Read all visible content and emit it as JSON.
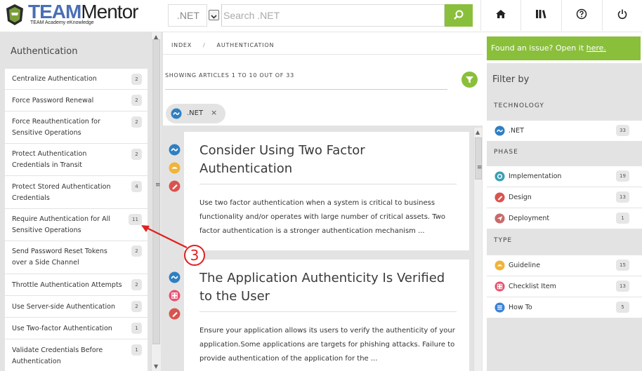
{
  "header": {
    "logo_brand": "TEAM",
    "logo_suffix": "Mentor",
    "logo_subtitle": "TEAM Academy eKnowledge",
    "technology_select": ".NET",
    "search_placeholder": "Search .NET",
    "icons": [
      "home-icon",
      "library-icon",
      "help-icon",
      "power-icon"
    ]
  },
  "left_sidebar": {
    "title": "Authentication",
    "items": [
      {
        "label": "Centralize Authentication",
        "count": "2"
      },
      {
        "label": "Force Password Renewal",
        "count": "2"
      },
      {
        "label": "Force Reauthentication for Sensitive Operations",
        "count": "2"
      },
      {
        "label": "Protect Authentication Credentials in Transit",
        "count": "2"
      },
      {
        "label": "Protect Stored Authentication Credentials",
        "count": "4"
      },
      {
        "label": "Require Authentication for All Sensitive Operations",
        "count": "11"
      },
      {
        "label": "Send Password Reset Tokens over a Side Channel",
        "count": "2"
      },
      {
        "label": "Throttle Authentication Attempts",
        "count": "2"
      },
      {
        "label": "Use Server-side Authentication",
        "count": "2"
      },
      {
        "label": "Use Two-factor Authentication",
        "count": "1"
      },
      {
        "label": "Validate Credentials Before Authentication",
        "count": "1"
      }
    ]
  },
  "breadcrumb": {
    "index": "INDEX",
    "separator": "/",
    "current": "AUTHENTICATION"
  },
  "results": {
    "showing_text": "SHOWING ARTICLES 1 TO 10 OUT OF 33",
    "active_filter": ".NET",
    "remove_symbol": "×"
  },
  "articles": [
    {
      "title": "Consider Using Two Factor Authentication",
      "body": "Use two factor authentication when a system is critical to business functionality and/or operates with large number of critical assets. Two factor authentication is a stronger authentication mechanism ...",
      "icons": [
        "dotnet-icon",
        "guideline-icon",
        "design-icon"
      ]
    },
    {
      "title": "The Application Authenticity Is Verified to the User",
      "body": "Ensure your application allows its users to verify the authenticity of your application.Some applications are targets for phishing attacks. Failure to provide authentication of the application for the ...",
      "icons": [
        "dotnet-icon",
        "checklist-icon",
        "design-icon"
      ]
    }
  ],
  "right_sidebar": {
    "issue_text": "Found an issue? Open it ",
    "issue_link": "here.",
    "filter_title": "Filter by",
    "technology_title": "TECHNOLOGY",
    "technology": [
      {
        "label": ".NET",
        "count": "33",
        "icon": "dotnet-icon"
      }
    ],
    "phase_title": "PHASE",
    "phase": [
      {
        "label": "Implementation",
        "count": "19",
        "icon": "implementation-icon"
      },
      {
        "label": "Design",
        "count": "13",
        "icon": "design-icon"
      },
      {
        "label": "Deployment",
        "count": "1",
        "icon": "deployment-icon"
      }
    ],
    "type_title": "TYPE",
    "type": [
      {
        "label": "Guideline",
        "count": "15",
        "icon": "guideline-icon"
      },
      {
        "label": "Checklist Item",
        "count": "13",
        "icon": "checklist-icon"
      },
      {
        "label": "How To",
        "count": "5",
        "icon": "howto-icon"
      }
    ]
  },
  "annotation": {
    "label": "3"
  },
  "colors": {
    "accent_green": "#8abf3c",
    "dotnet_blue": "#2f7fc1",
    "guideline_yellow": "#f0b43a",
    "design_red": "#d9534f",
    "implementation_teal": "#3a9fb5",
    "deployment_rose": "#c96a6a",
    "checklist_pink": "#e8506e",
    "howto_blue": "#3b82d6",
    "annotation_red": "#e02020"
  }
}
